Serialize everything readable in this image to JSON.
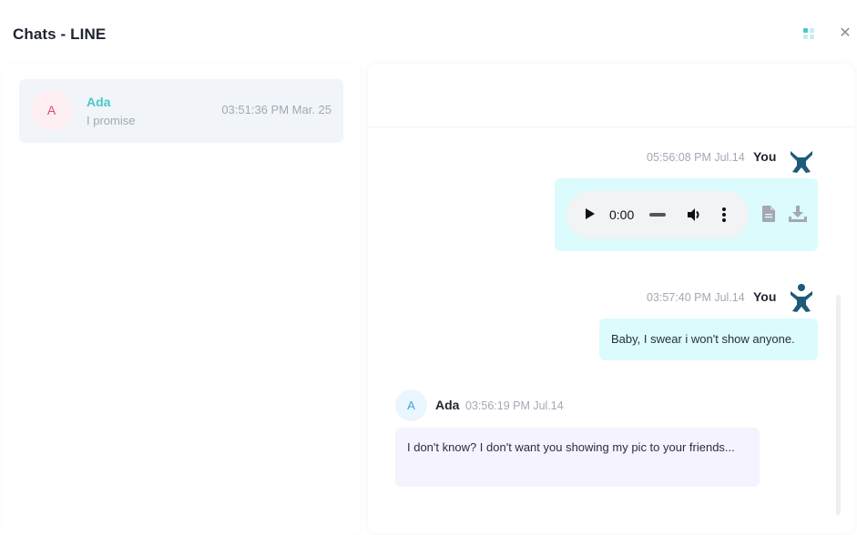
{
  "header": {
    "title": "Chats - LINE",
    "grid_icon": "grid-icon",
    "close_icon": "close-icon",
    "close_glyph": "✕"
  },
  "chat_list": [
    {
      "avatar_initial": "A",
      "name": "Ada",
      "preview": "I promise",
      "time": "03:51:36 PM Mar. 25"
    }
  ],
  "conversation": {
    "messages": [
      {
        "direction": "outgoing",
        "timestamp": "05:56:08 PM Jul.14",
        "sender": "You",
        "type": "audio",
        "audio": {
          "current_time": "0:00"
        },
        "actions": [
          "document-icon",
          "download-icon"
        ]
      },
      {
        "direction": "outgoing",
        "timestamp": "03:57:40 PM Jul.14",
        "sender": "You",
        "type": "text",
        "text": "Baby, I swear i won't show anyone."
      },
      {
        "direction": "incoming",
        "avatar_initial": "A",
        "sender": "Ada",
        "timestamp": "03:56:19 PM Jul.14",
        "type": "text",
        "text": "I don't know? I don't want you showing my pic to your friends..."
      }
    ]
  },
  "colors": {
    "accent": "#4cc7c6",
    "outgoing_bubble": "#dbfbfd",
    "incoming_bubble": "#f5f3fe",
    "you_avatar": "#1e5a7a"
  }
}
